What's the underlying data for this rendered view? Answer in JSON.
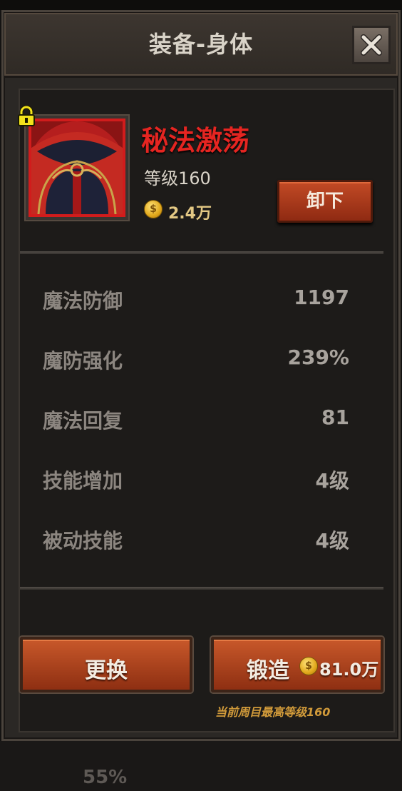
{
  "window": {
    "title": "装备-身体"
  },
  "item": {
    "name": "秘法激荡",
    "level": "等级160",
    "price": "2.4万",
    "locked": true,
    "name_color": "#e52521"
  },
  "actions": {
    "unequip_label": "卸下",
    "replace_label": "更换",
    "forge_label": "锻造",
    "forge_cost": "81.0万"
  },
  "stats": [
    {
      "label": "魔法防御",
      "value": "1197"
    },
    {
      "label": "魔防强化",
      "value": "239%"
    },
    {
      "label": "魔法回复",
      "value": "81"
    },
    {
      "label": "技能增加",
      "value": "4级"
    },
    {
      "label": "被动技能",
      "value": "4级"
    }
  ],
  "note": "当前周目最高等级160",
  "background_text": "55%",
  "icons": {
    "lock": "lock-icon",
    "close": "close-icon",
    "coin": "coin-icon"
  }
}
